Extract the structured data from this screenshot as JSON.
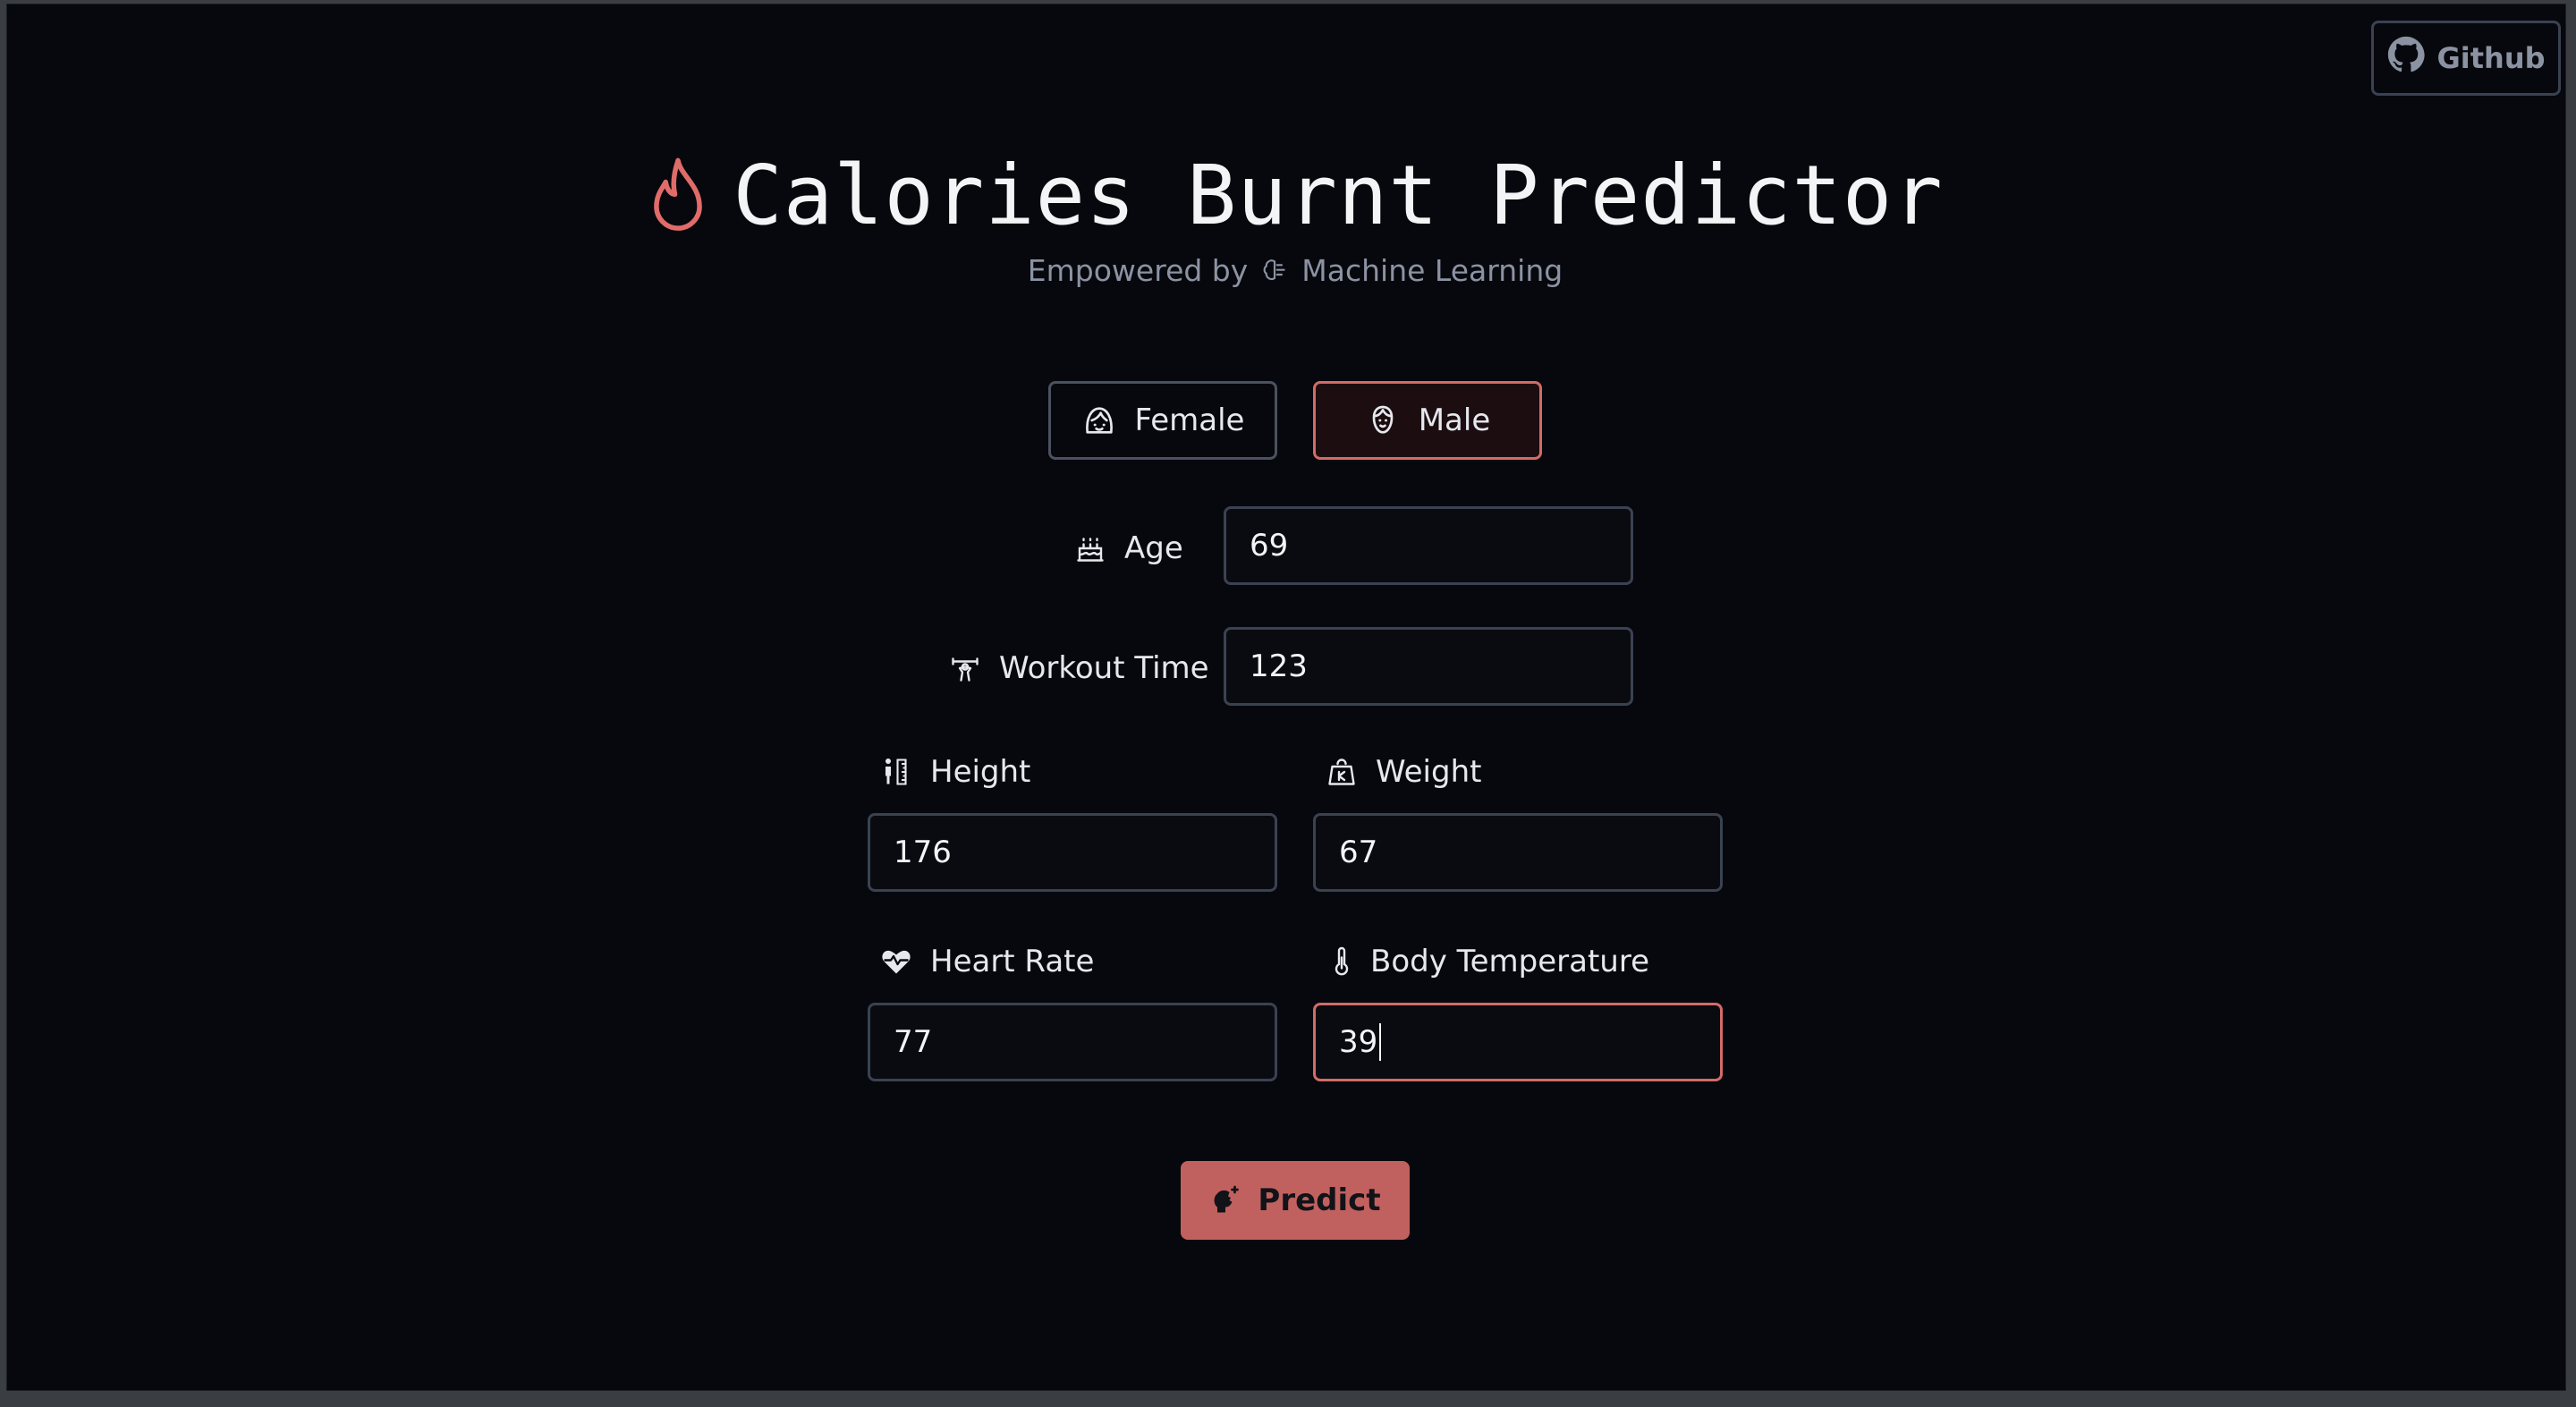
{
  "header": {
    "github_label": "Github",
    "title": "Calories Burnt Predictor",
    "subtitle_prefix": "Empowered by",
    "subtitle_suffix": "Machine Learning"
  },
  "gender": {
    "female_label": "Female",
    "male_label": "Male",
    "selected": "Male"
  },
  "fields": {
    "age": {
      "label": "Age",
      "value": "69"
    },
    "workout_time": {
      "label": "Workout Time",
      "value": "123"
    },
    "height": {
      "label": "Height",
      "value": "176"
    },
    "weight": {
      "label": "Weight",
      "value": "67"
    },
    "heart_rate": {
      "label": "Heart Rate",
      "value": "77"
    },
    "body_temperature": {
      "label": "Body Temperature",
      "value": "39"
    }
  },
  "actions": {
    "predict_label": "Predict"
  },
  "colors": {
    "background": "#07080d",
    "accent": "#d36b68",
    "button": "#c1615f",
    "border": "#3a4252",
    "text": "#e6e8ee",
    "muted": "#8b93a3"
  },
  "icons": {
    "github": "github-icon",
    "title": "flame-icon",
    "subtitle": "brain-icon",
    "female": "female-face-icon",
    "male": "male-face-icon",
    "age": "cake-icon",
    "workout_time": "weightlifting-icon",
    "height": "height-ruler-icon",
    "weight": "weight-scale-icon",
    "heart_rate": "heart-pulse-icon",
    "body_temperature": "thermometer-icon",
    "predict": "brain-sparkle-icon"
  }
}
